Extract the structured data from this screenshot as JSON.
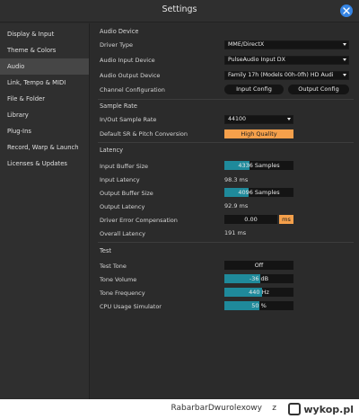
{
  "window": {
    "title": "Settings"
  },
  "sidebar": {
    "items": [
      {
        "label": "Display & Input"
      },
      {
        "label": "Theme & Colors"
      },
      {
        "label": "Audio"
      },
      {
        "label": "Link, Tempo & MIDI"
      },
      {
        "label": "File & Folder"
      },
      {
        "label": "Library"
      },
      {
        "label": "Plug-Ins"
      },
      {
        "label": "Record, Warp & Launch"
      },
      {
        "label": "Licenses & Updates"
      }
    ],
    "active_index": 2
  },
  "audio_device": {
    "header": "Audio Device",
    "driver_type_label": "Driver Type",
    "driver_type_value": "MME/DirectX",
    "input_device_label": "Audio Input Device",
    "input_device_value": "PulseAudio Input DX",
    "output_device_label": "Audio Output Device",
    "output_device_value": "Family 17h (Models 00h-0fh) HD Audi",
    "channel_config_label": "Channel Configuration",
    "input_config_button": "Input Config",
    "output_config_button": "Output Config"
  },
  "sample_rate": {
    "header": "Sample Rate",
    "in_out_label": "In/Out Sample Rate",
    "in_out_value": "44100",
    "default_sr_label": "Default SR & Pitch Conversion",
    "default_sr_value": "High Quality"
  },
  "latency": {
    "header": "Latency",
    "input_buffer_label": "Input Buffer Size",
    "input_buffer_value": "4336 Samples",
    "input_buffer_fill": 0.37,
    "input_latency_label": "Input Latency",
    "input_latency_value": "98.3 ms",
    "output_buffer_label": "Output Buffer Size",
    "output_buffer_value": "4096 Samples",
    "output_buffer_fill": 0.35,
    "output_latency_label": "Output Latency",
    "output_latency_value": "92.9 ms",
    "driver_error_label": "Driver Error Compensation",
    "driver_error_value": "0.00",
    "driver_error_unit": "ms",
    "overall_latency_label": "Overall Latency",
    "overall_latency_value": "191 ms"
  },
  "test": {
    "header": "Test",
    "tone_label": "Test Tone",
    "tone_value": "Off",
    "volume_label": "Tone Volume",
    "volume_value": "-36 dB",
    "volume_fill": 0.52,
    "frequency_label": "Tone Frequency",
    "frequency_value": "440 Hz",
    "frequency_fill": 0.55,
    "cpu_label": "CPU Usage Simulator",
    "cpu_value": "50 %",
    "cpu_fill": 0.5
  },
  "footer": {
    "username": "RabarbarDwurolexowy",
    "connector": "z",
    "brand": "wykop.pl"
  },
  "colors": {
    "accent_orange": "#f5a04b",
    "fill_teal": "#1f8a9b",
    "close_blue": "#3584e4"
  }
}
